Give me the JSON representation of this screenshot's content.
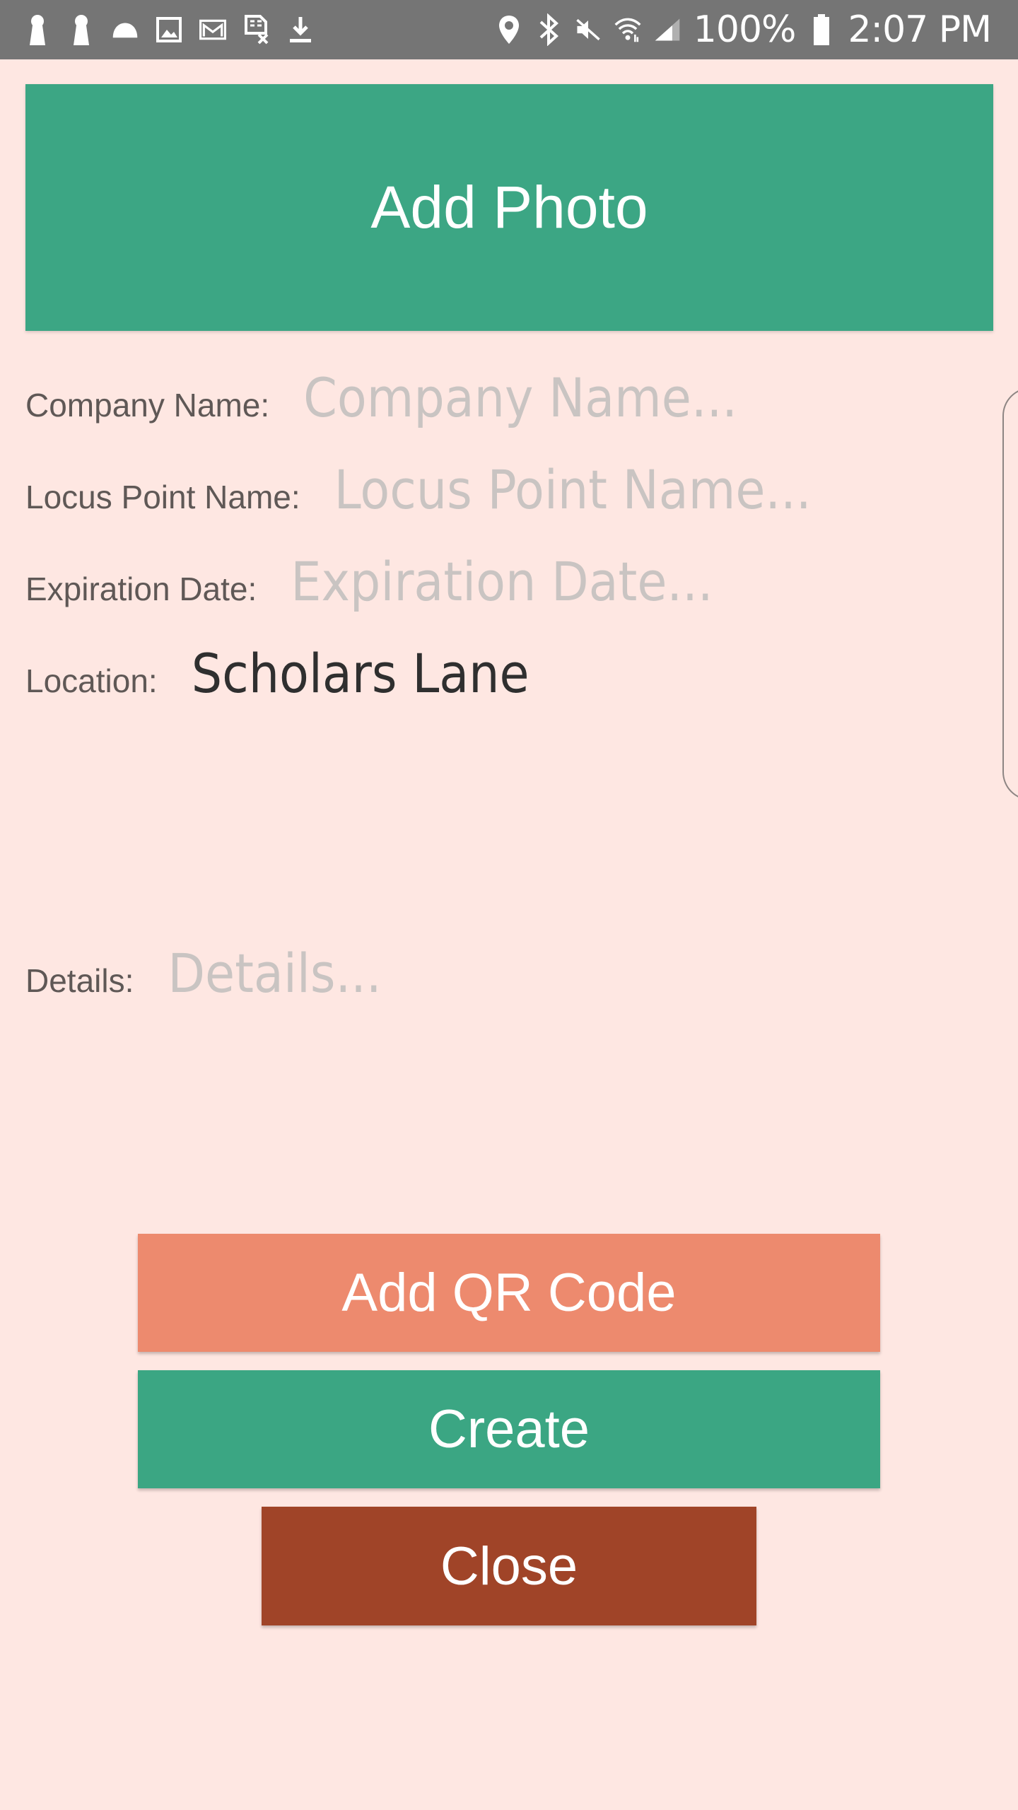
{
  "status_bar": {
    "left_icons": [
      "keyhole-icon",
      "keyhole-icon",
      "cloud-icon",
      "image-icon",
      "gmail-icon",
      "sim-off-icon",
      "download-icon"
    ],
    "right_icons": [
      "location-pin-icon",
      "bluetooth-icon",
      "mute-icon",
      "wifi-icon",
      "signal-icon",
      "battery-icon"
    ],
    "battery": "100%",
    "time": "2:07 PM"
  },
  "add_photo": {
    "label": "Add Photo"
  },
  "form": {
    "company": {
      "label": "Company Name:",
      "placeholder": "Company Name..."
    },
    "locus": {
      "label": "Locus Point Name:",
      "placeholder": "Locus Point Name..."
    },
    "expiration": {
      "label": "Expiration Date:",
      "placeholder": "Expiration Date..."
    },
    "location": {
      "label": "Location:",
      "value": "Scholars Lane"
    },
    "details": {
      "label": "Details:",
      "placeholder": "Details..."
    }
  },
  "buttons": {
    "add_qr": "Add QR Code",
    "create": "Create",
    "close": "Close"
  },
  "colors": {
    "background": "#fee7e2",
    "status_bar": "#757575",
    "green": "#3ca684",
    "salmon": "#ed8a6e",
    "rust": "#a04428"
  }
}
